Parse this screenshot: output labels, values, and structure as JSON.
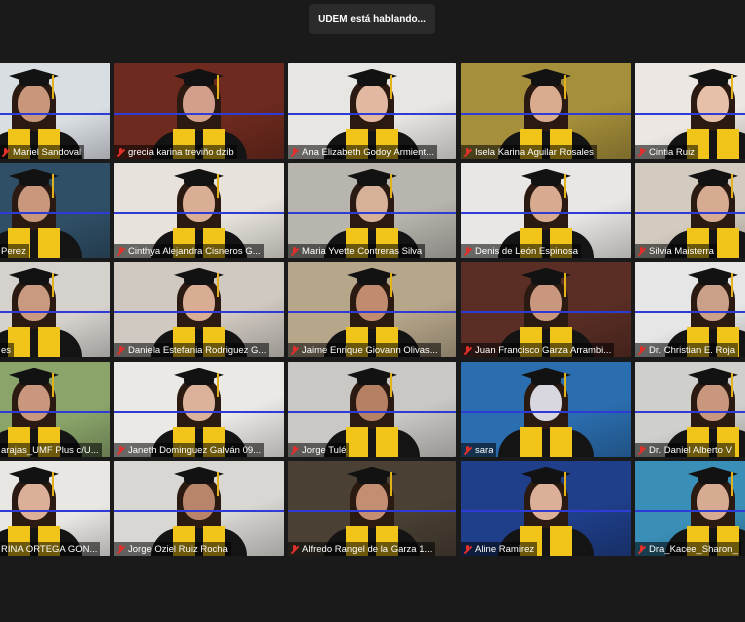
{
  "speaker_banner": "UDEM está hablando...",
  "participants": [
    {
      "name": "Mariel Sandoval",
      "muted": true,
      "bg": "#d9dee3",
      "skin": "#c8967a"
    },
    {
      "name": "grecia karina treviño dzib",
      "muted": true,
      "bg": "#6e2a1e",
      "skin": "#d2a08a"
    },
    {
      "name": "Ana Elizabeth Godoy Armient...",
      "muted": true,
      "bg": "#e8e6e2",
      "skin": "#e2b9a0"
    },
    {
      "name": "Isela Karina Aguilar Rosales",
      "muted": true,
      "bg": "#a58f3a",
      "skin": "#d9ab8f"
    },
    {
      "name": "Cintia Ruiz",
      "muted": true,
      "bg": "#ece7e2",
      "skin": "#e6c0a8"
    },
    {
      "name": "Perez",
      "muted": false,
      "bg": "#2f4f66",
      "skin": "#c9977b"
    },
    {
      "name": "Cinthya Alejandra Cisneros G...",
      "muted": true,
      "bg": "#e7e3dc",
      "skin": "#d9ae94"
    },
    {
      "name": "Maria Yvette Contreras Silva",
      "muted": true,
      "bg": "#b8b5ae",
      "skin": "#d7b098"
    },
    {
      "name": "Denis de León Espinosa",
      "muted": true,
      "bg": "#e9e7e5",
      "skin": "#d8aa90"
    },
    {
      "name": "Silvia Maisterra",
      "muted": true,
      "bg": "#d3cbbf",
      "skin": "#d7ab92"
    },
    {
      "name": "es",
      "muted": false,
      "bg": "#d5d2ce",
      "skin": "#c99a80"
    },
    {
      "name": "Daniela Estefania Rodriguez G...",
      "muted": true,
      "bg": "#cfc9c1",
      "skin": "#d8ad94"
    },
    {
      "name": "Jaime Enrique Giovann Olivas...",
      "muted": true,
      "bg": "#b6a68a",
      "skin": "#c08b6f"
    },
    {
      "name": "Juan Francisco Garza Arrambi...",
      "muted": true,
      "bg": "#5a2e24",
      "skin": "#c9977d"
    },
    {
      "name": "Dr. Christian E. Roja",
      "muted": true,
      "bg": "#e6e6e6",
      "skin": "#caa088"
    },
    {
      "name": "arajas_UMF Plus c/U...",
      "muted": false,
      "bg": "#8aa46a",
      "skin": "#c9977d"
    },
    {
      "name": "Janeth Dominguez Galván 09...",
      "muted": true,
      "bg": "#ebe9e6",
      "skin": "#dcb39a"
    },
    {
      "name": "Jorge Tulé",
      "muted": true,
      "bg": "#c9c8c4",
      "skin": "#b58064"
    },
    {
      "name": "sara",
      "muted": true,
      "bg": "#2b6eb0",
      "skin": "#d8d6de"
    },
    {
      "name": "Dr. Daniel Alberto V",
      "muted": true,
      "bg": "#cfcfcc",
      "skin": "#c9977d"
    },
    {
      "name": "RINA ORTEGA GON...",
      "muted": false,
      "bg": "#e9e7e4",
      "skin": "#dcb098"
    },
    {
      "name": "Jorge Oziel Ruiz Rocha",
      "muted": true,
      "bg": "#d9d7d3",
      "skin": "#b8856a"
    },
    {
      "name": "Alfredo Rangel de la Garza 1...",
      "muted": true,
      "bg": "#4a4034",
      "skin": "#c48e72"
    },
    {
      "name": "Aline Ramirez",
      "muted": true,
      "bg": "#1f3f8a",
      "skin": "#dcb098"
    },
    {
      "name": "Dra_Kacee_Sharon_",
      "muted": true,
      "bg": "#3a8fb8",
      "skin": "#d7aa92"
    }
  ]
}
